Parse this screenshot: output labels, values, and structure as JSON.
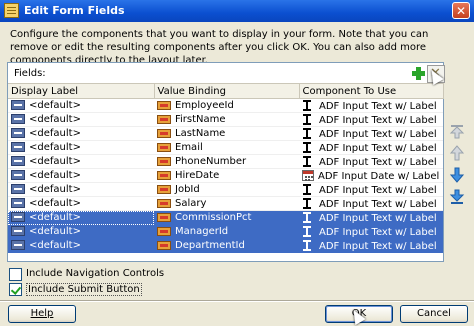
{
  "window": {
    "title": "Edit Form Fields",
    "close_glyph": "✕"
  },
  "description": "Configure the components that you want to display in your form.  Note that you can remove or edit the resulting components after you click OK.  You can also add more components directly to the layout later.",
  "fields": {
    "label": "Fields:",
    "add_icon": "green-plus-icon",
    "delete_icon": "delete-x-icon",
    "columns": [
      "Display Label",
      "Value Binding",
      "Component To Use"
    ],
    "rows": [
      {
        "label": "<default>",
        "binding": "EmployeeId",
        "component": "ADF Input Text w/ Label",
        "icon": "text",
        "selected": false
      },
      {
        "label": "<default>",
        "binding": "FirstName",
        "component": "ADF Input Text w/ Label",
        "icon": "text",
        "selected": false
      },
      {
        "label": "<default>",
        "binding": "LastName",
        "component": "ADF Input Text w/ Label",
        "icon": "text",
        "selected": false
      },
      {
        "label": "<default>",
        "binding": "Email",
        "component": "ADF Input Text w/ Label",
        "icon": "text",
        "selected": false
      },
      {
        "label": "<default>",
        "binding": "PhoneNumber",
        "component": "ADF Input Text w/ Label",
        "icon": "text",
        "selected": false
      },
      {
        "label": "<default>",
        "binding": "HireDate",
        "component": "ADF Input Date w/ Label",
        "icon": "date",
        "selected": false
      },
      {
        "label": "<default>",
        "binding": "JobId",
        "component": "ADF Input Text w/ Label",
        "icon": "text",
        "selected": false
      },
      {
        "label": "<default>",
        "binding": "Salary",
        "component": "ADF Input Text w/ Label",
        "icon": "text",
        "selected": false
      },
      {
        "label": "<default>",
        "binding": "CommissionPct",
        "component": "ADF Input Text w/ Label",
        "icon": "text",
        "selected": true
      },
      {
        "label": "<default>",
        "binding": "ManagerId",
        "component": "ADF Input Text w/ Label",
        "icon": "text",
        "selected": true
      },
      {
        "label": "<default>",
        "binding": "DepartmentId",
        "component": "ADF Input Text w/ Label",
        "icon": "text",
        "selected": true
      }
    ]
  },
  "side_buttons": [
    "move-top-icon",
    "move-up-icon",
    "move-down-icon",
    "move-bottom-icon"
  ],
  "options": {
    "navigation_controls": {
      "label": "Include Navigation Controls",
      "checked": false
    },
    "submit_button": {
      "label": "Include Submit Button",
      "checked": true
    }
  },
  "buttons": {
    "help": "Help",
    "ok": "OK",
    "cancel": "Cancel"
  },
  "colors": {
    "selection": "#3e6bc4",
    "title_bar": "#0b4fd0"
  }
}
